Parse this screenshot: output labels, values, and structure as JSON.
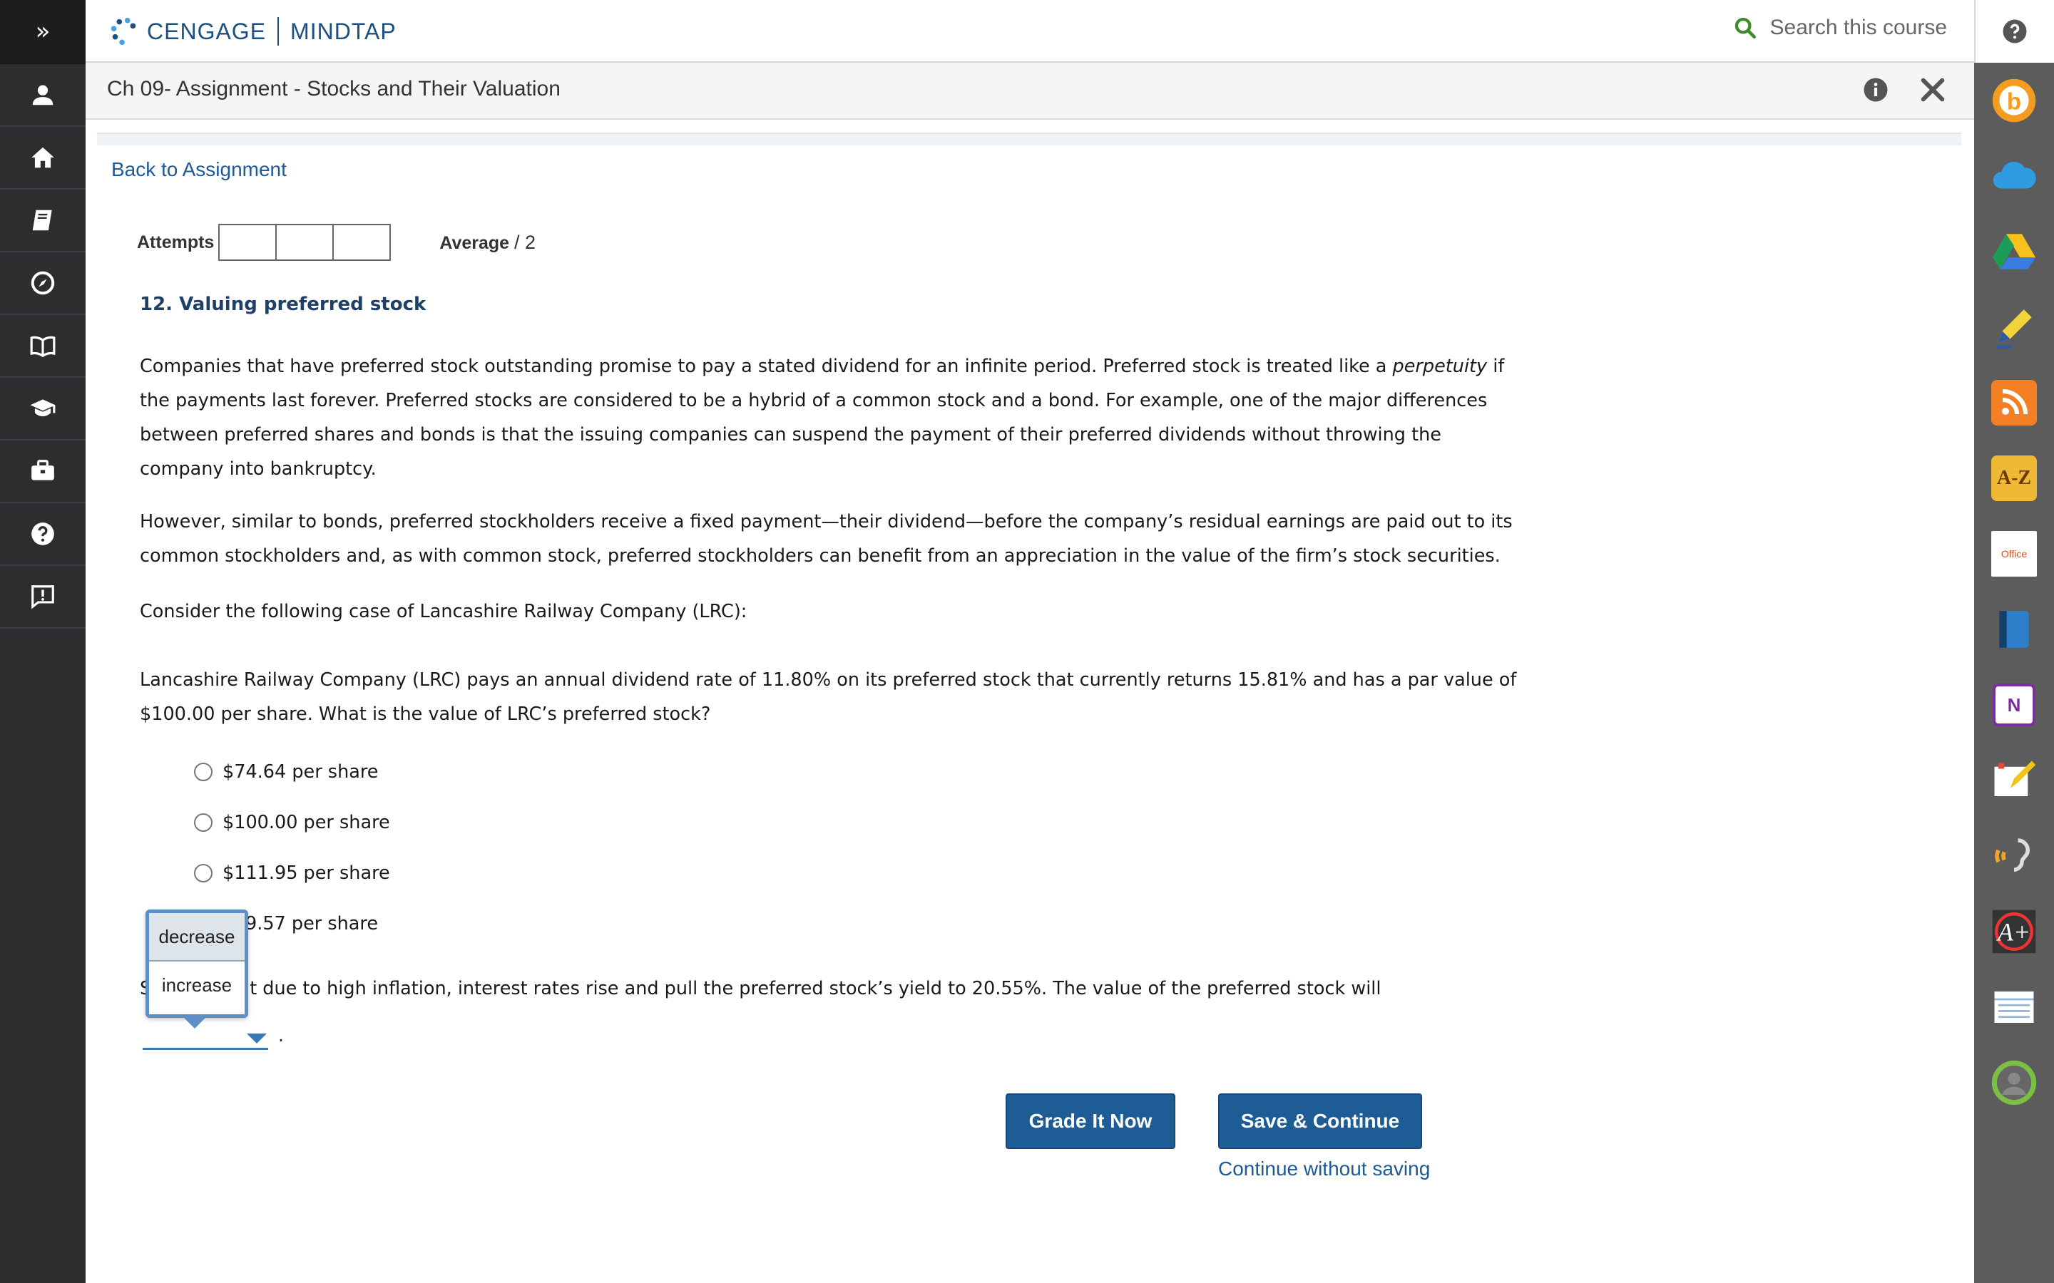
{
  "header": {
    "brand_left": "CENGAGE",
    "brand_right": "MINDTAP",
    "search_placeholder": "Search this course"
  },
  "activity": {
    "title": "Ch 09- Assignment - Stocks and Their Valuation"
  },
  "nav": {
    "back_link": "Back to Assignment"
  },
  "attempts": {
    "label": "Attempts",
    "average_label": "Average",
    "average_value": "/ 2"
  },
  "question": {
    "title": "12. Valuing preferred stock",
    "p1_a": "Companies that have preferred stock outstanding promise to pay a stated dividend for an infinite period. Preferred stock is treated like a ",
    "p1_em": "perpetuity",
    "p1_b": " if the payments last forever. Preferred stocks are considered to be a hybrid of a common stock and a bond. For example, one of the major differences between preferred shares and bonds is that the issuing companies can suspend the payment of their preferred dividends without throwing the company into bankruptcy.",
    "p2": "However, similar to bonds, preferred stockholders receive a fixed payment—their dividend—before the company’s residual earnings are paid out to its common stockholders and, as with common stock, preferred stockholders can benefit from an appreciation in the value of the firm’s stock securities.",
    "p3": "Consider the following case of Lancashire Railway Company (LRC):",
    "p4": "Lancashire Railway Company (LRC) pays an annual dividend rate of 11.80% on its preferred stock that currently returns 15.81% and has a par value of $100.00 per share. What is the value of LRC’s preferred stock?",
    "options": [
      "$74.64 per share",
      "$100.00 per share",
      "$111.95 per share",
      "9.57 per share"
    ],
    "sentence_prefix": "S",
    "sentence": "t due to high inflation, interest rates rise and pull the preferred stock’s yield to 20.55%. The value of the preferred stock will",
    "period": "."
  },
  "dropdown": {
    "options": [
      "decrease",
      "increase"
    ],
    "highlighted": "decrease"
  },
  "buttons": {
    "grade": "Grade It Now",
    "save": "Save & Continue",
    "continue_without_saving": "Continue without saving"
  },
  "right_rail_apps": {
    "az_label": "A-Z",
    "office_label": "Office",
    "onenote_label": "N"
  },
  "colors": {
    "primary": "#1e5c95",
    "link": "#1d5a96",
    "left_rail": "#2b2d2f",
    "right_rail": "#5c5c5c"
  }
}
